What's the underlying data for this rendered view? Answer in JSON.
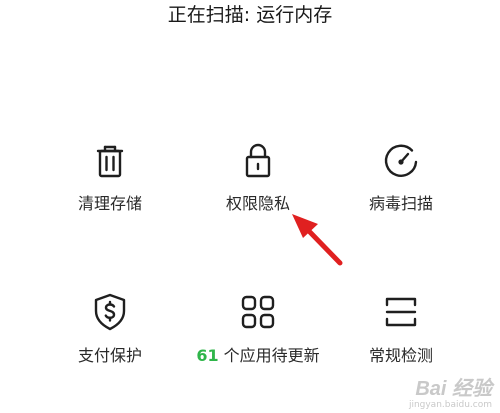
{
  "scan_status": "正在扫描: 运行内存",
  "tools": [
    {
      "label": "清理存储",
      "icon": "trash-icon"
    },
    {
      "label": "权限隐私",
      "icon": "lock-icon"
    },
    {
      "label": "病毒扫描",
      "icon": "scan-gauge-icon"
    },
    {
      "label": "支付保护",
      "icon": "dollar-shield-icon"
    },
    {
      "label_count": "61",
      "label_suffix": " 个应用待更新",
      "icon": "apps-grid-icon"
    },
    {
      "label": "常规检测",
      "icon": "bracket-scan-icon"
    }
  ],
  "annotation": {
    "color": "#e02020"
  },
  "watermark": {
    "main": "Bai 经验",
    "sub": "jingyan.baidu.com"
  }
}
